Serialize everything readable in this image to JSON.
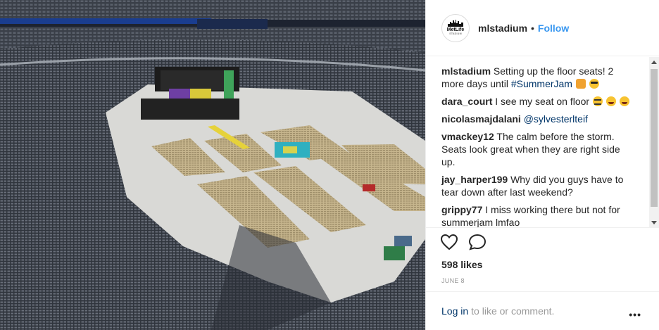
{
  "photo": {
    "alt_icon": "stadium-photo"
  },
  "header": {
    "avatar_text": "MetLife",
    "avatar_sub": "STADIUM",
    "username": "mlstadium",
    "separator": "•",
    "follow_label": "Follow"
  },
  "comments": [
    {
      "user": "mlstadium",
      "text": "Setting up the floor seats! 2 more days until ",
      "link": "#SummerJam",
      "emoji": [
        "hands",
        "shades"
      ]
    },
    {
      "user": "dara_court",
      "text": "I see my seat on floor ",
      "link": "",
      "emoji": [
        "screw",
        "laugh",
        "laugh"
      ]
    },
    {
      "user": "nicolasmajdalani",
      "text": "",
      "link": "@sylvesterlteif",
      "emoji": []
    },
    {
      "user": "vmackey12",
      "text": "The calm before the storm. Seats look great when they are right side up.",
      "link": "",
      "emoji": []
    },
    {
      "user": "jay_harper199",
      "text": "Why did you guys have to tear down after last weekend?",
      "link": "",
      "emoji": []
    },
    {
      "user": "grippy77",
      "text": "I miss working there but not for summerjam lmfao",
      "link": "",
      "emoji": []
    }
  ],
  "actions": {
    "like_icon": "heart-icon",
    "comment_icon": "comment-icon"
  },
  "likes": "598 likes",
  "date": "JUNE 8",
  "login": {
    "link": "Log in",
    "text": "to like or comment.",
    "more": "•••"
  },
  "colors": {
    "accent": "#3897f0",
    "link": "#003569",
    "muted": "#999999"
  }
}
